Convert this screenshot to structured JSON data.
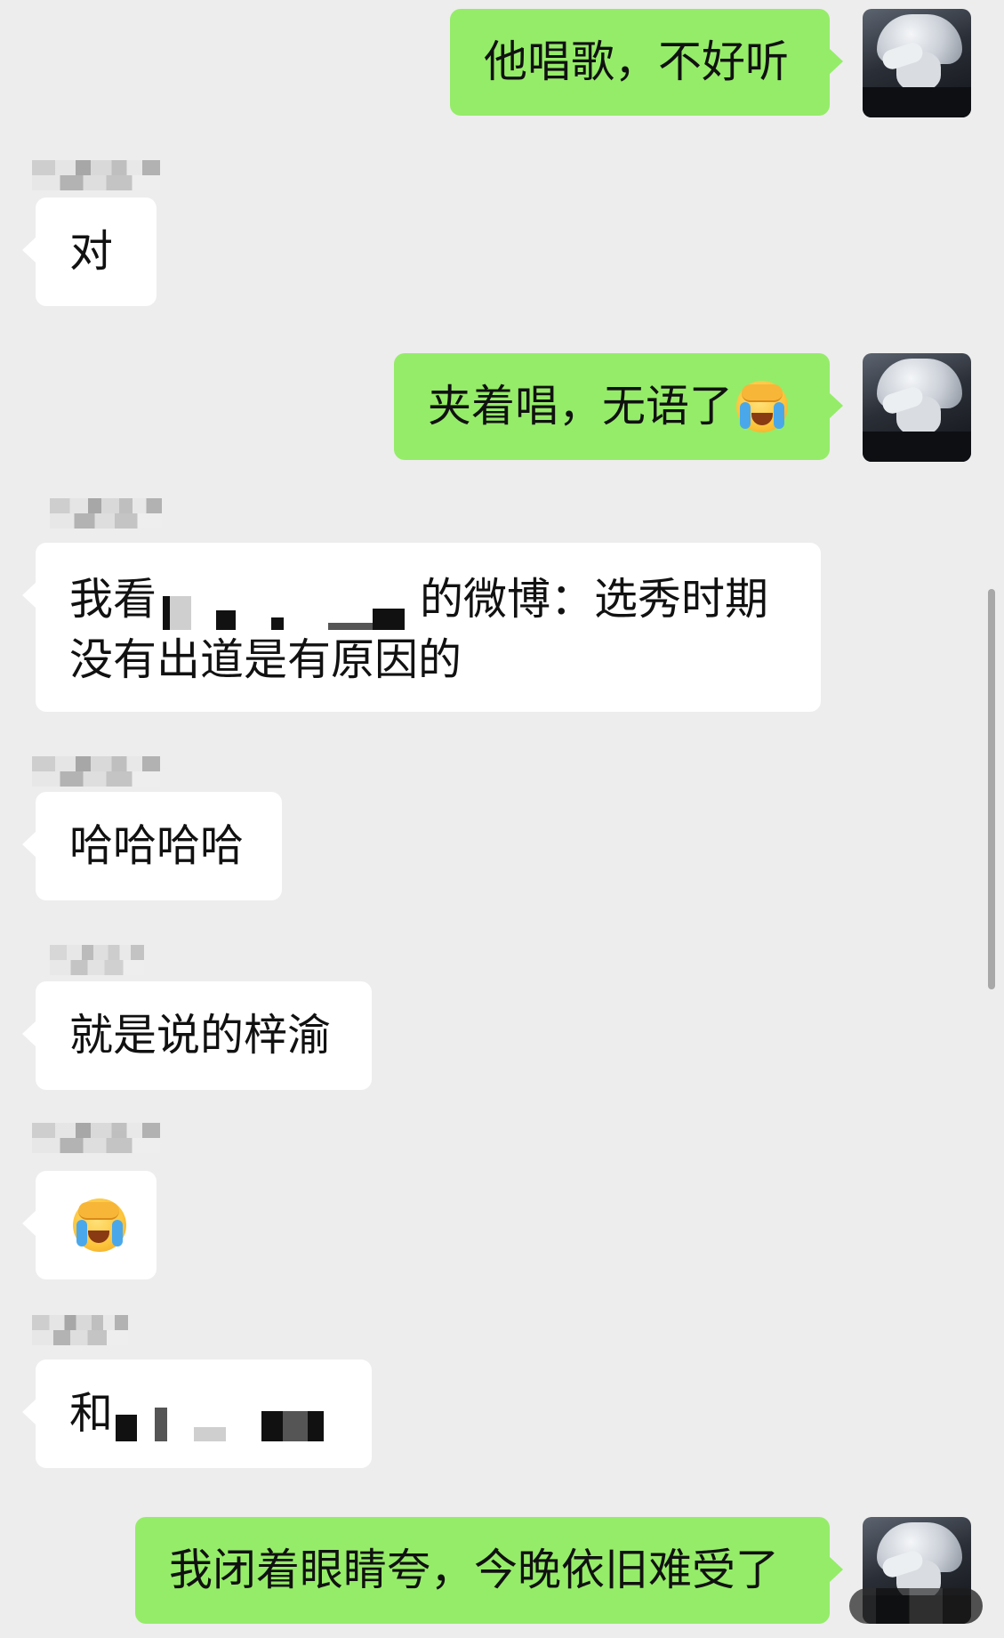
{
  "messages": [
    {
      "side": "out",
      "text": "他唱歌，不好听"
    },
    {
      "side": "in",
      "text": "对"
    },
    {
      "side": "out",
      "text": "夹着唱，无语了",
      "emoji": "facepalm-crying-emoji"
    },
    {
      "side": "in",
      "text_before": "我看",
      "text_after": "的微博：选秀时期没有出道是有原因的",
      "redacted": true
    },
    {
      "side": "in",
      "text": "哈哈哈哈"
    },
    {
      "side": "in",
      "text": "就是说的梓渝"
    },
    {
      "side": "in",
      "emoji": "facepalm-crying-emoji"
    },
    {
      "side": "in",
      "text_before": "和",
      "redacted": true
    },
    {
      "side": "out",
      "text": "我闭着眼睛夸，今晚依旧难受了"
    }
  ],
  "colors": {
    "background": "#ededed",
    "outgoing_bubble": "#95ec69",
    "incoming_bubble": "#ffffff"
  },
  "icons": {
    "avatar": "anime-white-hair-avatar",
    "emoji": "facepalm-crying-emoji"
  }
}
